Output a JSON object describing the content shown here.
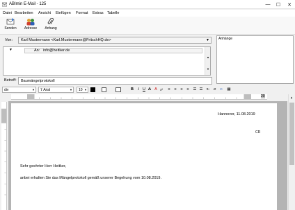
{
  "window": {
    "title": "ABImin E-Mail - 125"
  },
  "menu": [
    "Datei",
    "Bearbeiten",
    "Ansicht",
    "Einfügen",
    "Format",
    "Extras",
    "Tabelle"
  ],
  "toolbar": {
    "send": "Senden",
    "address": "Adresse",
    "attachment": "Anhang"
  },
  "header": {
    "from_label": "Von:",
    "from_value": "Karl Mustermann <Karl.Mustermann@FritschHQ.de>",
    "to_label": "An:",
    "to_value": "info@heitker.de",
    "subject_label": "Betreff:",
    "subject_value": "Baumängelprotokoll"
  },
  "attachments": {
    "label": "Anhänge"
  },
  "format": {
    "style": "div",
    "font": "Arial",
    "size": "10"
  },
  "ruler": {
    "end_value": "20"
  },
  "document": {
    "date_line": "Hannover, 11.08.2019",
    "initials": "CR",
    "salutation": "Sehr geehrter Herr Heitker,",
    "body": "anbei erhalten Sie das Mängelprotokoll gemäß unserer Begehung vom 10.08.2019."
  }
}
